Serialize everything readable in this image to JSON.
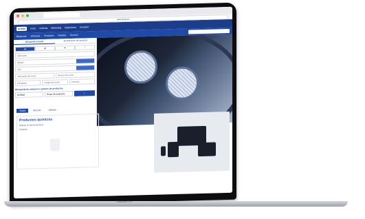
{
  "browser": {
    "tab_title": "",
    "url": "www.elring.es"
  },
  "app": {
    "logo": "ELRING",
    "header_items": [
      "Inicio",
      "Noticias",
      "Marketing",
      "Estaciones",
      "Contacto"
    ],
    "nav_items": [
      "Búsqueda",
      "Vehículos",
      "Productos",
      "Pedidos",
      "Servicio"
    ]
  },
  "left_panel": {
    "tab_active": "Búsqueda manual",
    "tab_other": "Identificación del producto",
    "icons": [
      "car-icon",
      "bus-icon",
      "truck-icon",
      "cone-icon"
    ],
    "fields": [
      "Fabricante",
      "Modelo",
      "Tipo"
    ],
    "section2_fields": [
      "Fabricante del motor",
      "Número de motor",
      "Cilindrada"
    ],
    "section3_fields": [
      "Código del motor",
      "Potencia"
    ],
    "section_title": "Búsqueda de números y grupos de productos",
    "search_value": "ELRING",
    "search_option": "Grupo de productos",
    "search_button": "Buscar"
  },
  "bottom_tabs": [
    "Todos",
    "Artículo",
    "Ofertas"
  ],
  "card": {
    "title": "Productos químicos",
    "lines": [
      "Sellador de alta temperatura",
      "Limpiador"
    ]
  },
  "brand": "MacBook Pro",
  "colors": {
    "primary": "#1f4aa8",
    "header": "#1c3d8c"
  }
}
